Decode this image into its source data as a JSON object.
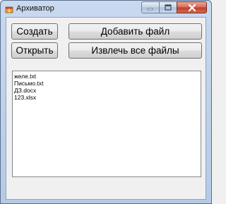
{
  "window": {
    "title": "Архиватор",
    "icon": "archive-app-icon"
  },
  "toolbar": {
    "create_label": "Создать",
    "add_file_label": "Добавить файл",
    "open_label": "Открыть",
    "extract_all_label": "Извлечь все файлы"
  },
  "files": [
    "желе.txt",
    "Письмо.txt",
    "ДЗ.docx",
    "123.xlsx"
  ]
}
